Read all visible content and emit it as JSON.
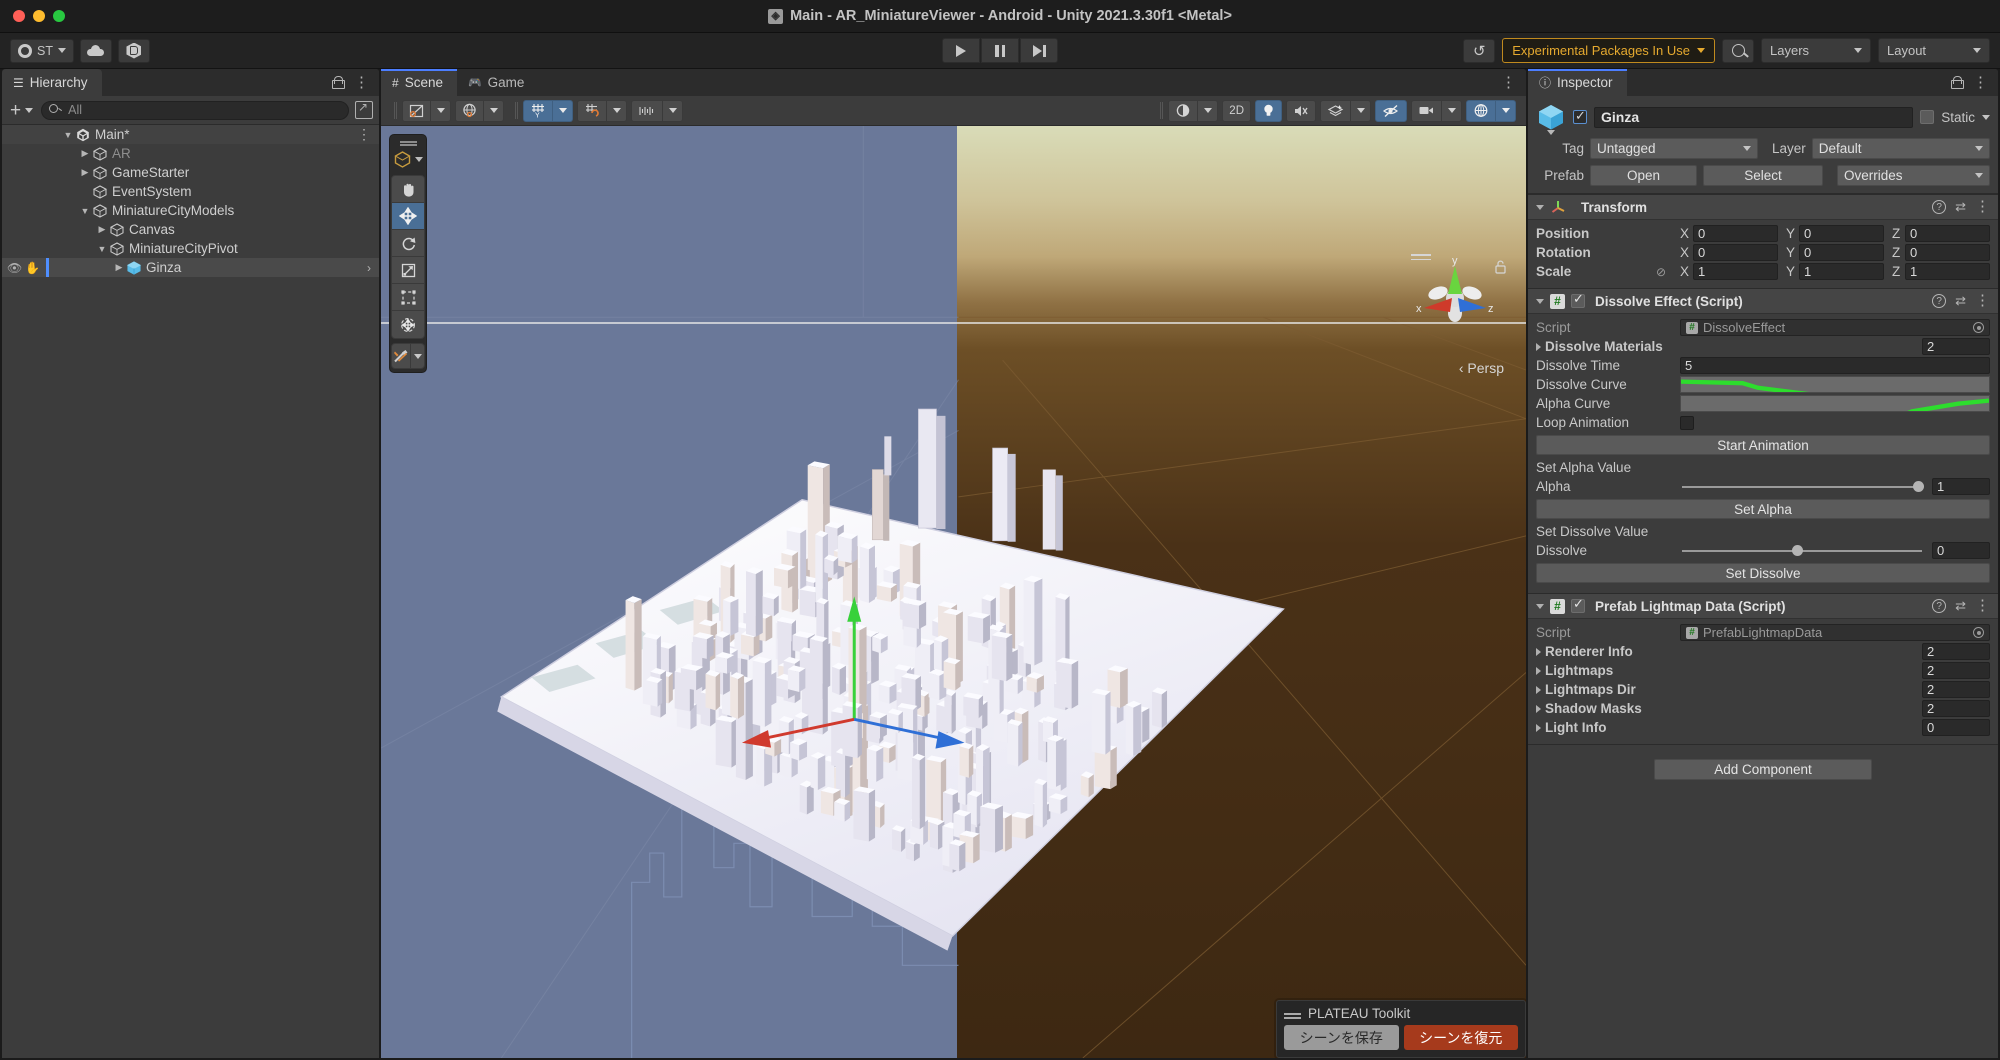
{
  "window": {
    "title": "Main - AR_MiniatureViewer - Android - Unity 2021.3.30f1 <Metal>"
  },
  "toolbar": {
    "account_label": "ST",
    "cloud_icon": "cloud-icon",
    "services_icon": "unity-services-icon",
    "play_icon": "play-icon",
    "pause_icon": "pause-icon",
    "step_icon": "step-icon",
    "history_icon": "undo-history-icon",
    "experimental_label": "Experimental Packages In Use",
    "search_icon": "search-icon",
    "layers_label": "Layers",
    "layout_label": "Layout"
  },
  "hierarchy": {
    "tab_label": "Hierarchy",
    "search_placeholder": "All",
    "items": [
      {
        "label": "Main*",
        "depth": 0,
        "twist": "down",
        "dim": false,
        "root": true,
        "selected": false
      },
      {
        "label": "AR",
        "depth": 1,
        "twist": "right",
        "dim": true,
        "root": false,
        "selected": false
      },
      {
        "label": "GameStarter",
        "depth": 1,
        "twist": "right",
        "dim": false,
        "root": false,
        "selected": false
      },
      {
        "label": "EventSystem",
        "depth": 1,
        "twist": "none",
        "dim": false,
        "root": false,
        "selected": false
      },
      {
        "label": "MiniatureCityModels",
        "depth": 1,
        "twist": "down",
        "dim": false,
        "root": false,
        "selected": false
      },
      {
        "label": "Canvas",
        "depth": 2,
        "twist": "right",
        "dim": false,
        "root": false,
        "selected": false
      },
      {
        "label": "MiniatureCityPivot",
        "depth": 2,
        "twist": "down",
        "dim": false,
        "root": false,
        "selected": false
      },
      {
        "label": "Ginza",
        "depth": 3,
        "twist": "right",
        "dim": false,
        "root": false,
        "selected": true
      }
    ]
  },
  "scene": {
    "tabs": [
      {
        "label": "Scene",
        "icon": "grid-icon",
        "active": true
      },
      {
        "label": "Game",
        "icon": "gamepad-icon",
        "active": false
      }
    ],
    "toolbar": {
      "shading_icon": "shaded-mode-icon",
      "draw_icon": "2d-wireframe-icon",
      "globe_icon": "scene-lighting-globe-icon",
      "grid_icon": "grid-visibility-icon",
      "snap_icon": "grid-snapping-icon",
      "ruler_icon": "component-tools-icon",
      "gizmos_icon": "gizmos-icon",
      "mode_2d_label": "2D",
      "light_icon": "scene-lighting-icon",
      "audio_icon": "scene-audio-mute-icon",
      "fx_icon": "effects-icon",
      "hidden_icon": "scene-visibility-icon",
      "camera_icon": "scene-camera-icon",
      "gizmo_toggle_icon": "gizmo-dropdown-icon"
    },
    "tools": [
      {
        "icon": "hand-tool-icon",
        "active": false
      },
      {
        "icon": "move-tool-icon",
        "active": true
      },
      {
        "icon": "rotate-tool-icon",
        "active": false
      },
      {
        "icon": "scale-tool-icon",
        "active": false
      },
      {
        "icon": "rect-tool-icon",
        "active": false
      },
      {
        "icon": "transform-tool-icon",
        "active": false
      }
    ],
    "pivot_icon": "pivot-center-icon",
    "custom_tool_icon": "custom-tools-icon",
    "view_mode_label": "Persp",
    "gizmo_axes": {
      "x": "x",
      "y": "y",
      "z": "z"
    }
  },
  "plateau": {
    "title": "PLATEAU Toolkit",
    "save_label": "シーンを保存",
    "restore_label": "シーンを復元"
  },
  "inspector": {
    "tab_label": "Inspector",
    "object_name": "Ginza",
    "enabled": true,
    "static_label": "Static",
    "tag_label": "Tag",
    "tag_value": "Untagged",
    "layer_label": "Layer",
    "layer_value": "Default",
    "prefab_label": "Prefab",
    "open_label": "Open",
    "select_label": "Select",
    "overrides_label": "Overrides",
    "transform": {
      "title": "Transform",
      "rows": [
        {
          "label": "Position",
          "x": "0",
          "y": "0",
          "z": "0"
        },
        {
          "label": "Rotation",
          "x": "0",
          "y": "0",
          "z": "0"
        },
        {
          "label": "Scale",
          "x": "1",
          "y": "1",
          "z": "1"
        }
      ],
      "axis_labels": {
        "x": "X",
        "y": "Y",
        "z": "Z"
      },
      "scale_lock_icon": "constrained-proportions-off-icon"
    },
    "dissolve_effect": {
      "title": "Dissolve Effect (Script)",
      "enabled": true,
      "script_label": "Script",
      "script_value": "DissolveEffect",
      "materials_label": "Dissolve Materials",
      "materials_count": "2",
      "time_label": "Dissolve Time",
      "time_value": "5",
      "dissolve_curve_label": "Dissolve Curve",
      "alpha_curve_label": "Alpha Curve",
      "loop_label": "Loop Animation",
      "loop_checked": false,
      "start_animation_label": "Start Animation",
      "set_alpha_section": "Set Alpha Value",
      "alpha_label": "Alpha",
      "alpha_value": "1",
      "alpha_slider_pct": 100,
      "set_alpha_label": "Set Alpha",
      "set_dissolve_section": "Set Dissolve Value",
      "dissolve_label": "Dissolve",
      "dissolve_value": "0",
      "dissolve_slider_pct": 48,
      "set_dissolve_label": "Set Dissolve"
    },
    "prefab_lightmap": {
      "title": "Prefab Lightmap Data (Script)",
      "enabled": true,
      "script_label": "Script",
      "script_value": "PrefabLightmapData",
      "rows": [
        {
          "label": "Renderer Info",
          "value": "2"
        },
        {
          "label": "Lightmaps",
          "value": "2"
        },
        {
          "label": "Lightmaps Dir",
          "value": "2"
        },
        {
          "label": "Shadow Masks",
          "value": "2"
        },
        {
          "label": "Light Info",
          "value": "0"
        }
      ]
    },
    "add_component_label": "Add Component"
  },
  "colors": {
    "accent_blue": "#4a6f96",
    "warning_amber": "#e5a92f",
    "panel_bg": "#3c3c3c",
    "chrome_bg": "#232323",
    "sky_left": "#6a7899",
    "sky_right": "#b09368",
    "ground_right": "#4a3117",
    "curve_green": "#2ddd2d",
    "plateau_red": "#a63a1c"
  }
}
